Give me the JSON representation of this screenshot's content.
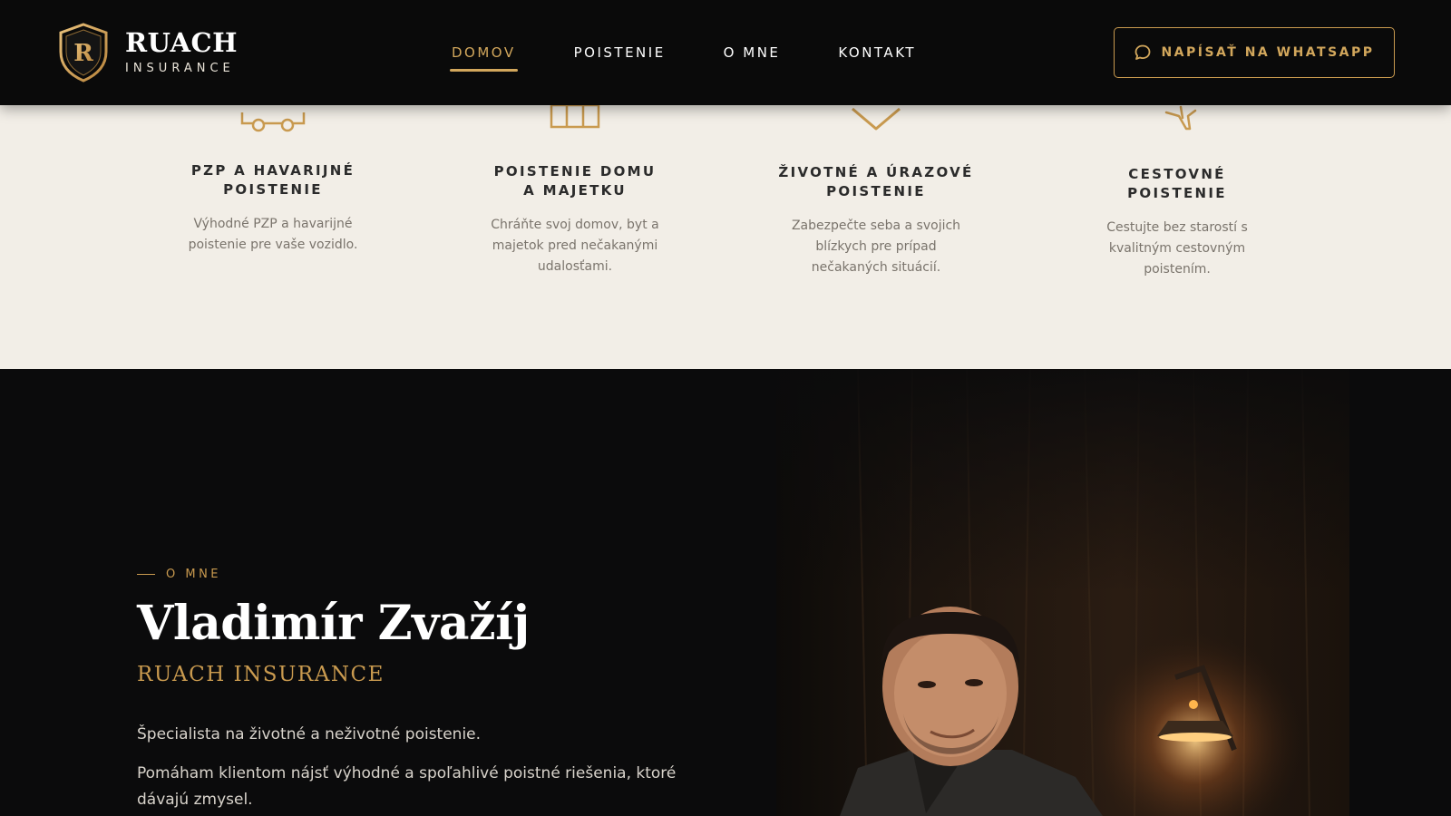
{
  "brand": {
    "initial": "R",
    "name": "RUACH",
    "tagline": "INSURANCE",
    "accent_color": "#d2a75c"
  },
  "nav": {
    "items": [
      {
        "label": "DOMOV",
        "active": true
      },
      {
        "label": "POISTENIE",
        "active": false
      },
      {
        "label": "O MNE",
        "active": false
      },
      {
        "label": "KONTAKT",
        "active": false
      }
    ]
  },
  "header_cta": {
    "label": "NAPÍSAŤ NA WHATSAPP",
    "icon": "chat-bubble-icon"
  },
  "services": [
    {
      "icon": "car-icon",
      "title_line1": "PZP A HAVARIJNÉ",
      "title_line2": "POISTENIE",
      "desc": "Výhodné PZP a havarijné poistenie pre vaše vozidlo."
    },
    {
      "icon": "house-icon",
      "title_line1": "POISTENIE DOMU",
      "title_line2": "A MAJETKU",
      "desc": "Chráňte svoj domov, byt a majetok pred nečakanými udalosťami."
    },
    {
      "icon": "heart-icon",
      "title_line1": "ŽIVOTNÉ A ÚRAZOVÉ",
      "title_line2": "POISTENIE",
      "desc": "Zabezpečte seba a svojich blízkych pre prípad nečakaných situácií."
    },
    {
      "icon": "airplane-icon",
      "title_line1": "CESTOVNÉ",
      "title_line2": "POISTENIE",
      "desc": "Cestujte bez starostí s kvalitným cestovným poistením."
    }
  ],
  "about": {
    "eyebrow": "O MNE",
    "name": "Vladimír Zvažíj",
    "company": "RUACH INSURANCE",
    "paragraph1": "Špecialista na životné a neživotné poistenie.",
    "paragraph2": "Pomáham klientom nájsť výhodné a spoľahlivé poistné riešenia, ktoré dávajú zmysel."
  }
}
